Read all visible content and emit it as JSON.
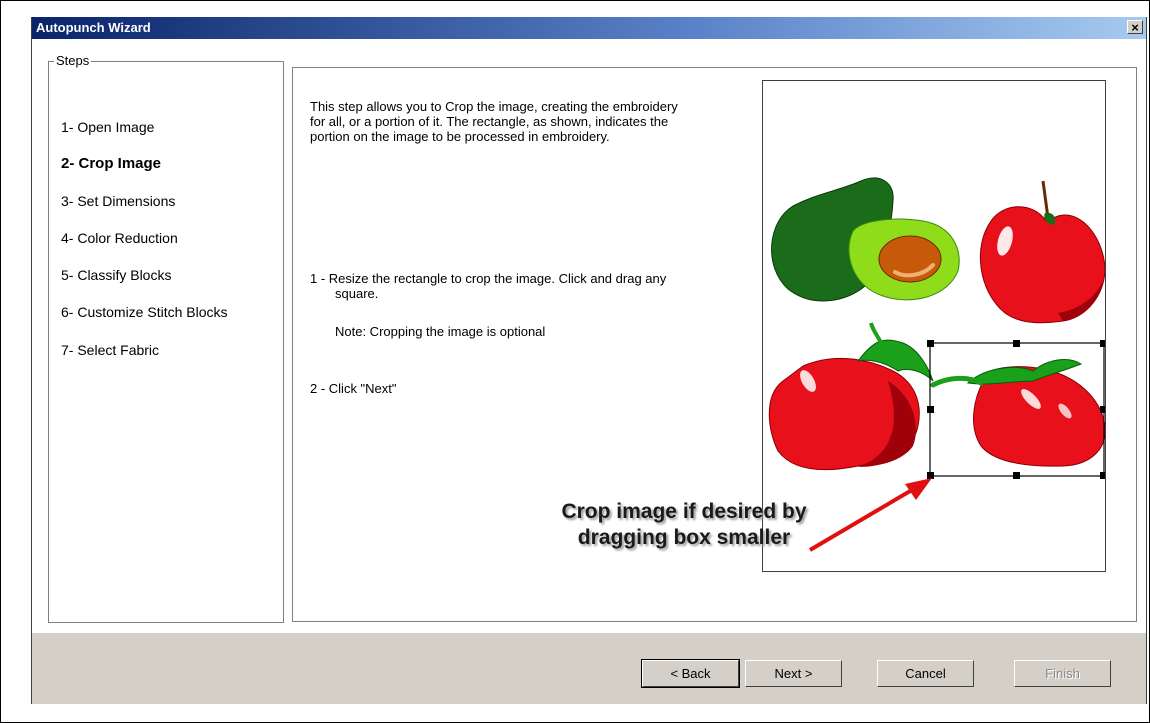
{
  "window": {
    "title": "Autopunch Wizard",
    "close_glyph": "×"
  },
  "steps": {
    "legend": "Steps",
    "items": [
      {
        "label": "1- Open Image",
        "active": false
      },
      {
        "label": "2- Crop Image",
        "active": true
      },
      {
        "label": "3- Set Dimensions",
        "active": false
      },
      {
        "label": "4- Color Reduction",
        "active": false
      },
      {
        "label": "5- Classify Blocks",
        "active": false
      },
      {
        "label": "6- Customize Stitch Blocks",
        "active": false
      },
      {
        "label": "7- Select Fabric",
        "active": false
      }
    ]
  },
  "main": {
    "intro_lines": [
      "This step allows you to Crop the image, creating the embroidery",
      "for all, or a portion of it. The rectangle, as shown, indicates the",
      "portion on the image to be processed in embroidery."
    ],
    "instruction1_lines": [
      "1 -  Resize the rectangle to crop the image. Click and drag any",
      "square."
    ],
    "note": "Note: Cropping the image is optional",
    "instruction2": "2 -  Click \"Next\""
  },
  "callout": {
    "lines": [
      "Crop image if desired by",
      "dragging box smaller"
    ],
    "arrow_color": "#e01010"
  },
  "buttons": {
    "back": "< Back",
    "next": "Next >",
    "cancel": "Cancel",
    "finish": "Finish"
  },
  "colors": {
    "title_bar_start": "#0a246a",
    "dialog_face": "#d4d0c8",
    "avocado_dark": "#1a6b1a",
    "avocado_flesh": "#8fdc1a",
    "fruit_red": "#e8101a"
  }
}
